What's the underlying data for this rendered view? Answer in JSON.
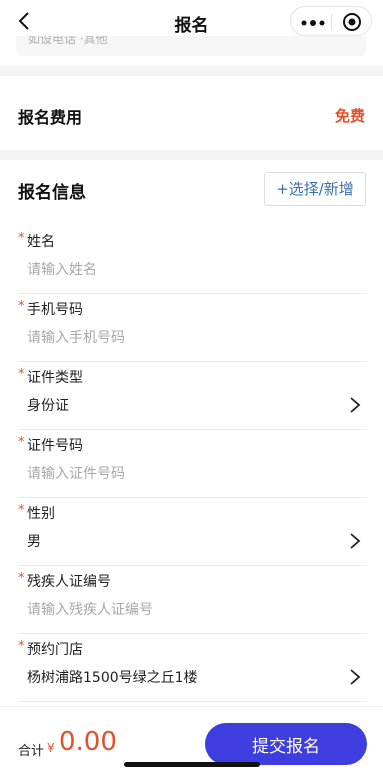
{
  "navbar": {
    "title": "报名",
    "back_icon": "chevron-left-icon",
    "more_icon": "more-dots-icon",
    "target_icon": "target-icon"
  },
  "top_card": {
    "text": "如设电话 ·其他"
  },
  "fee": {
    "label": "报名费用",
    "value": "免费"
  },
  "info": {
    "title": "报名信息",
    "select_button": "+选择/新增",
    "fields": [
      {
        "label": "姓名",
        "required": true,
        "placeholder": "请输入姓名",
        "value": "",
        "type": "input"
      },
      {
        "label": "手机号码",
        "required": true,
        "placeholder": "请输入手机号码",
        "value": "",
        "type": "input"
      },
      {
        "label": "证件类型",
        "required": true,
        "placeholder": "",
        "value": "身份证",
        "type": "select"
      },
      {
        "label": "证件号码",
        "required": true,
        "placeholder": "请输入证件号码",
        "value": "",
        "type": "input"
      },
      {
        "label": "性别",
        "required": true,
        "placeholder": "",
        "value": "男",
        "type": "select"
      },
      {
        "label": "残疾人证编号",
        "required": true,
        "placeholder": "请输入残疾人证编号",
        "value": "",
        "type": "input"
      },
      {
        "label": "预约门店",
        "required": true,
        "placeholder": "",
        "value": "杨树浦路1500号绿之丘1楼",
        "type": "select"
      }
    ]
  },
  "footer": {
    "total_label": "合计",
    "currency": "¥",
    "amount": "0.00",
    "submit_label": "提交报名"
  },
  "colors": {
    "accent": "#e0522b",
    "primary": "#3d3de0",
    "link": "#3a6fb0"
  }
}
